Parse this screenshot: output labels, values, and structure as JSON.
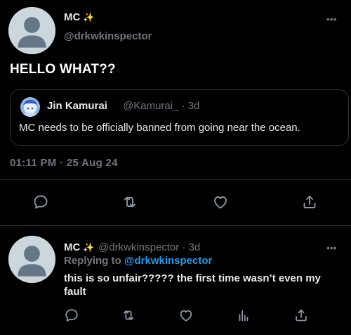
{
  "main_tweet": {
    "display_name": "MC",
    "sparkle": "✨",
    "handle": "@drkwkinspector",
    "text": "HELLO WHAT??",
    "more": "•••",
    "timestamp": "01:11 PM · 25 Aug 24"
  },
  "quoted_tweet": {
    "display_name": "Jin Kamurai",
    "meta": "@Kamurai_ · 3d",
    "text": "MC needs to be officially banned from going near the ocean."
  },
  "actions": [
    "reply-icon",
    "retweet-icon",
    "like-icon",
    "share-icon"
  ],
  "reply": {
    "display_name": "MC",
    "sparkle": "✨",
    "meta": "@drkwkinspector · 3d",
    "replying_prefix": "Replying to",
    "replying_handle": "@drkwkinspector",
    "text": "this is so unfair????? the first time wasn’t even my fault",
    "more": "•••",
    "actions": [
      "reply-icon",
      "retweet-icon",
      "like-icon",
      "analytics-icon",
      "share-icon"
    ]
  },
  "colors": {
    "background": "#000000",
    "text": "#e7e9ea",
    "secondary": "#71767b",
    "accent": "#1d9bf0",
    "border": "#2f3336"
  }
}
